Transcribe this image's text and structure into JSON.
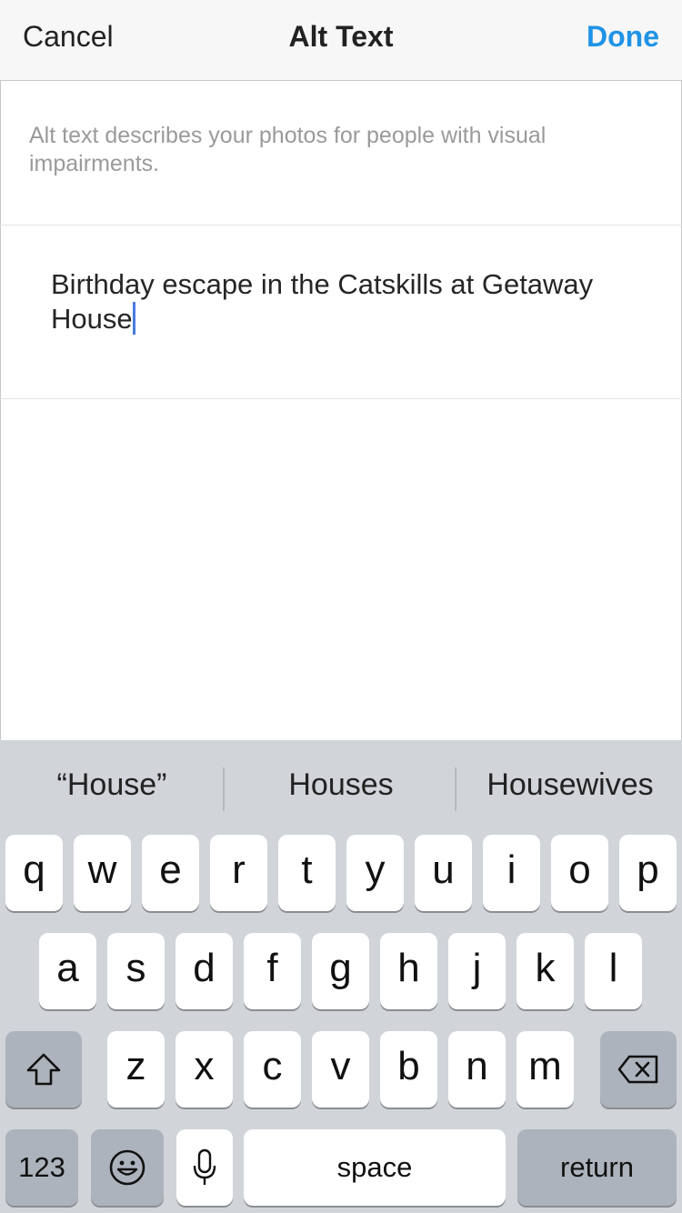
{
  "header": {
    "cancel_label": "Cancel",
    "title": "Alt Text",
    "done_label": "Done",
    "accent_color": "#1f93e6"
  },
  "description": "Alt text describes your photos for people with visual impairments.",
  "alt_text_value": "Birthday escape in the Catskills at Getaway House",
  "keyboard": {
    "suggestions": [
      "“House”",
      "Houses",
      "Housewives"
    ],
    "row1": [
      "q",
      "w",
      "e",
      "r",
      "t",
      "y",
      "u",
      "i",
      "o",
      "p"
    ],
    "row2": [
      "a",
      "s",
      "d",
      "f",
      "g",
      "h",
      "j",
      "k",
      "l"
    ],
    "row3": [
      "z",
      "x",
      "c",
      "v",
      "b",
      "n",
      "m"
    ],
    "numbers_label": "123",
    "space_label": "space",
    "return_label": "return",
    "icons": {
      "shift": "shift-icon",
      "backspace": "backspace-icon",
      "emoji": "emoji-icon",
      "mic": "microphone-icon"
    }
  }
}
